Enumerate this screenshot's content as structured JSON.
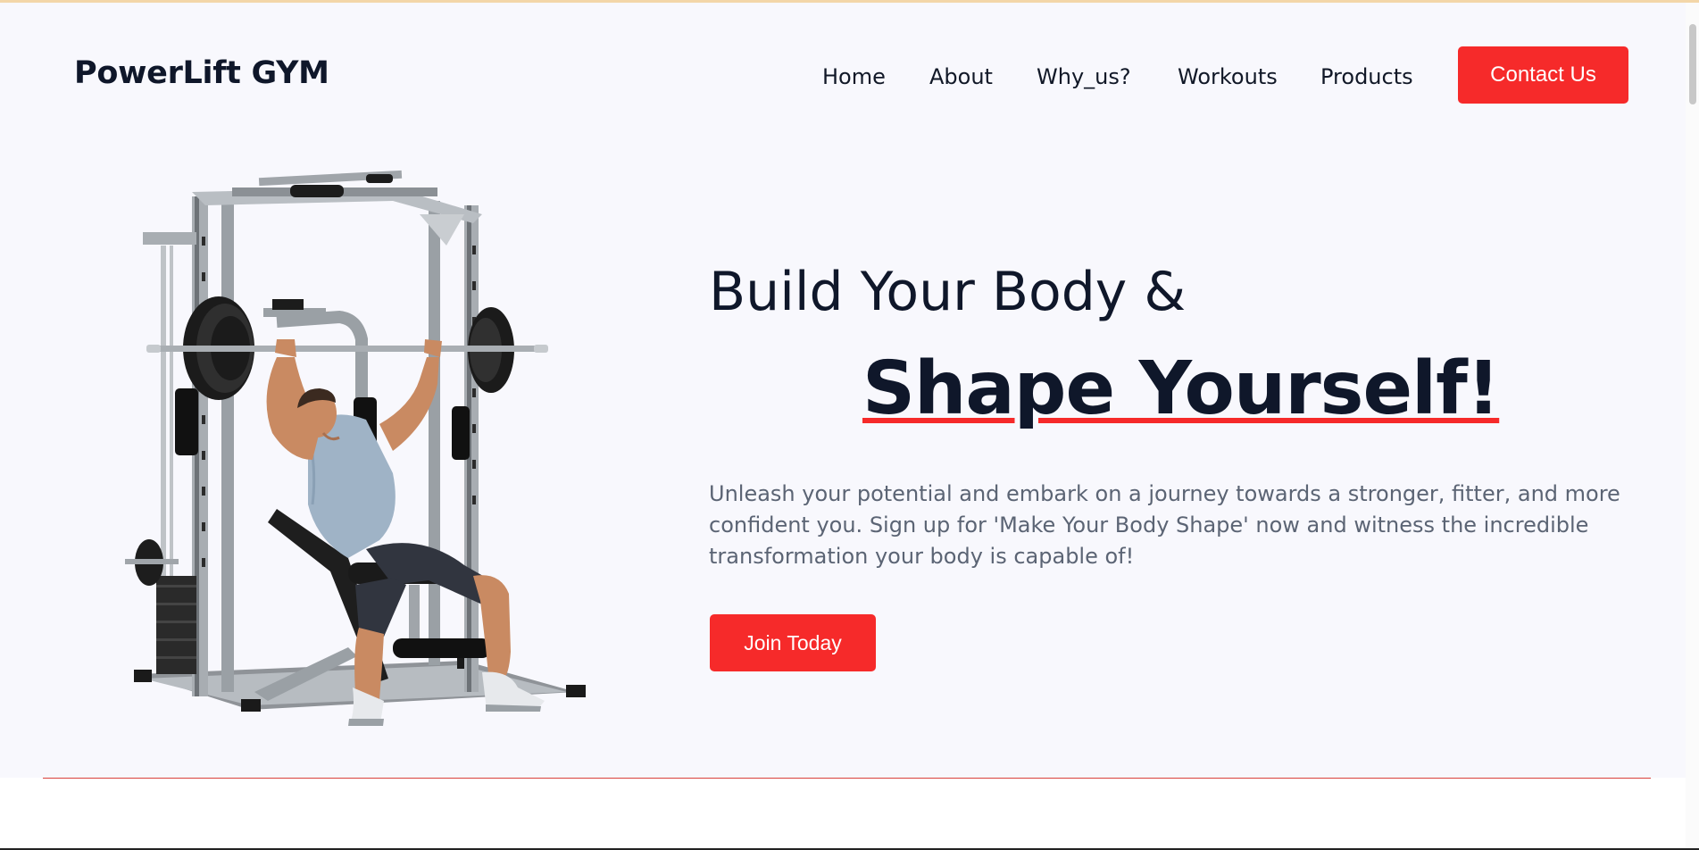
{
  "header": {
    "logo": "PowerLift GYM",
    "nav": [
      "Home",
      "About",
      "Why_us?",
      "Workouts",
      "Products"
    ],
    "contact_label": "Contact Us"
  },
  "hero": {
    "heading_line1": "Build Your Body &",
    "heading_line2": "Shape Yourself!",
    "description": "Unleash your potential and embark on a journey towards a stronger, fitter, and more confident you. Sign up for 'Make Your Body Shape' now and witness the incredible transformation your body is capable of!",
    "cta_label": "Join Today",
    "image_icon": "gym-machine-athlete-illustration"
  },
  "colors": {
    "accent": "#f62a2a",
    "text_dark": "#0f172a",
    "text_muted": "#5b6474",
    "background": "#f8f8fd"
  }
}
